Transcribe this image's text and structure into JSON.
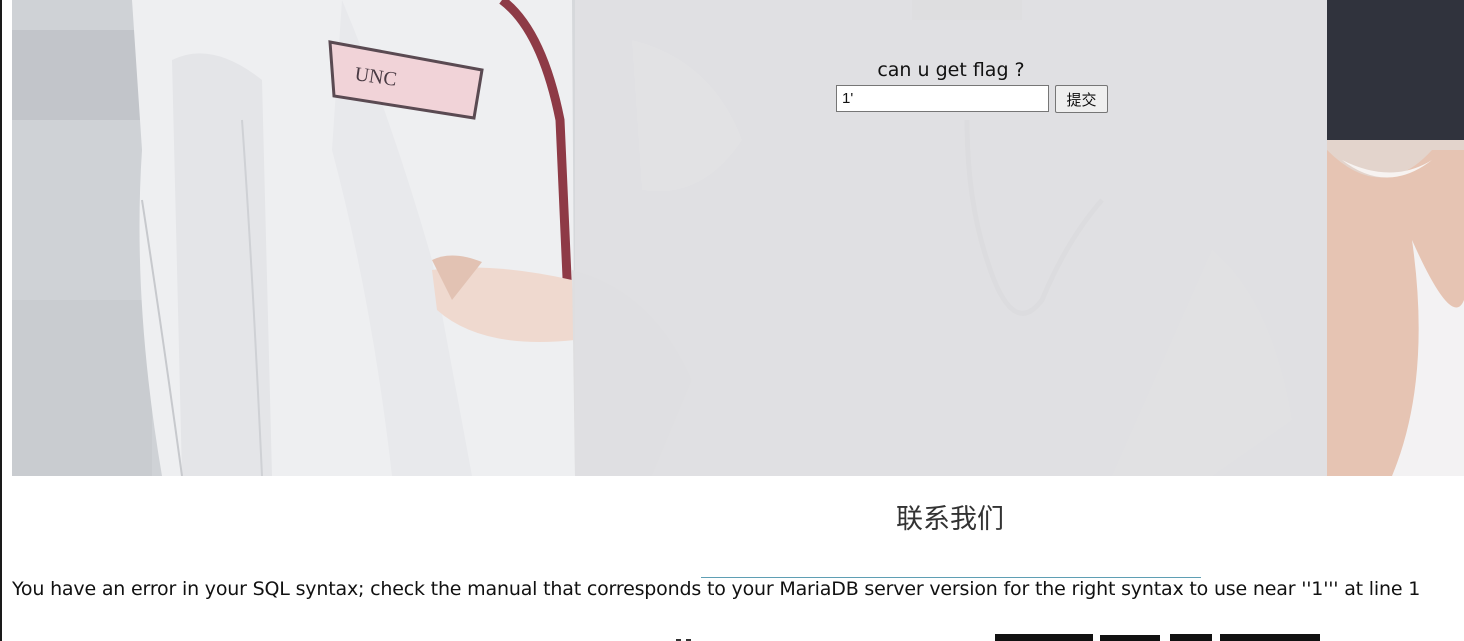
{
  "form": {
    "prompt": "can u get flag ?",
    "input_value": "1'",
    "submit_label": "提交"
  },
  "contact": {
    "heading": "联系我们"
  },
  "sql_error": {
    "message": "You have an error in your SQL syntax; check the manual that corresponds to your MariaDB server version for the right syntax to use near ''1''' at line 1"
  },
  "colors": {
    "panel_overlay": "#dfdfe1",
    "heading_rule": "#5f9fb4",
    "page_background": "#ffffff"
  },
  "icons": {
    "hero": "doctor-photo-background"
  }
}
